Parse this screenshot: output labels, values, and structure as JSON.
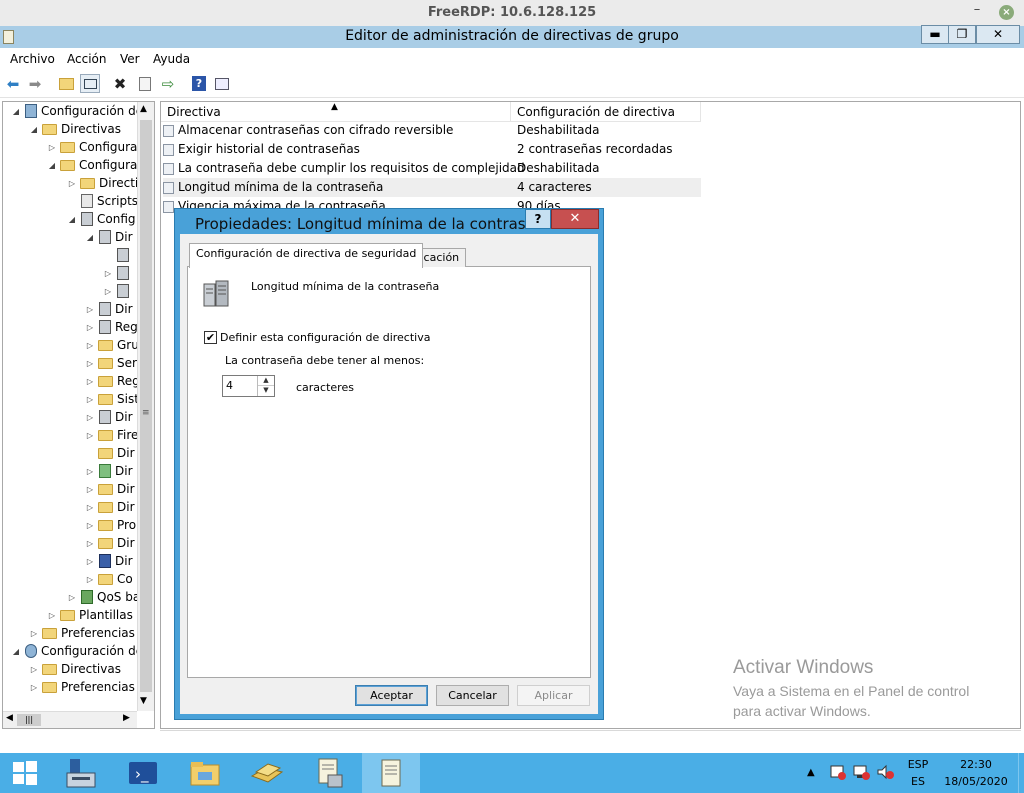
{
  "rdp": {
    "title": "FreeRDP: 10.6.128.125",
    "minimize": "–",
    "close": "×"
  },
  "app": {
    "title": "Editor de administración de directivas de grupo",
    "window_buttons": {
      "minimize": "▬",
      "restore": "❐",
      "close": "✕"
    }
  },
  "menu": [
    "Archivo",
    "Acción",
    "Ver",
    "Ayuda"
  ],
  "toolbar_icons": [
    "back-arrow-icon",
    "forward-arrow-icon",
    "up-folder-icon",
    "show-hide-tree-icon",
    "delete-icon",
    "properties-icon",
    "export-icon",
    "help-icon",
    "view-icon"
  ],
  "tree": [
    {
      "label": "Configuración de",
      "icon": "computer-icon"
    },
    {
      "label": "Directivas",
      "icon": "folder-icon"
    },
    {
      "label": "Configura",
      "icon": "folder-icon"
    },
    {
      "label": "Configura",
      "icon": "folder-icon"
    },
    {
      "label": "Directi",
      "icon": "folder-icon"
    },
    {
      "label": "Scripts",
      "icon": "script-icon"
    },
    {
      "label": "Config",
      "icon": "security-icon"
    },
    {
      "label": "Dir",
      "icon": "policy-icon"
    },
    {
      "label": "",
      "icon": "policy-icon"
    },
    {
      "label": "",
      "icon": "policy-icon"
    },
    {
      "label": "",
      "icon": "policy-icon"
    },
    {
      "label": "Dir",
      "icon": "policy-icon"
    },
    {
      "label": "Reg",
      "icon": "registry-icon"
    },
    {
      "label": "Gru",
      "icon": "lock-folder-icon"
    },
    {
      "label": "Ser",
      "icon": "lock-folder-icon"
    },
    {
      "label": "Reg",
      "icon": "lock-folder-icon"
    },
    {
      "label": "Sist",
      "icon": "lock-folder-icon"
    },
    {
      "label": "Dir",
      "icon": "network-icon"
    },
    {
      "label": "Fire",
      "icon": "folder-icon"
    },
    {
      "label": "Dir",
      "icon": "folder-icon"
    },
    {
      "label": "Dir",
      "icon": "chart-icon"
    },
    {
      "label": "Dir",
      "icon": "folder-icon"
    },
    {
      "label": "Dir",
      "icon": "folder-icon"
    },
    {
      "label": "Pro",
      "icon": "folder-icon"
    },
    {
      "label": "Dir",
      "icon": "folder-icon"
    },
    {
      "label": "Dir",
      "icon": "shield-icon"
    },
    {
      "label": "Co",
      "icon": "folder-icon"
    },
    {
      "label": "QoS ba",
      "icon": "qos-chart-icon"
    },
    {
      "label": "Plantillas a",
      "icon": "folder-icon"
    },
    {
      "label": "Preferencias",
      "icon": "folder-icon"
    },
    {
      "label": "Configuración de",
      "icon": "user-icon"
    },
    {
      "label": "Directivas",
      "icon": "folder-icon"
    },
    {
      "label": "Preferencias",
      "icon": "folder-icon"
    }
  ],
  "list": {
    "columns": [
      "Directiva",
      "Configuración de directiva"
    ],
    "rows": [
      {
        "name": "Almacenar contraseñas con cifrado reversible",
        "value": "Deshabilitada"
      },
      {
        "name": "Exigir historial de contraseñas",
        "value": "2 contraseñas recordadas"
      },
      {
        "name": "La contraseña debe cumplir los requisitos de complejidad",
        "value": "Deshabilitada"
      },
      {
        "name": "Longitud mínima de la contraseña",
        "value": "4 caracteres"
      },
      {
        "name": "Vigencia máxima de la contraseña",
        "value": "90 días"
      }
    ]
  },
  "watermark": {
    "title": "Activar Windows",
    "line1": "Vaya a Sistema en el Panel de control",
    "line2": "para activar Windows."
  },
  "dialog": {
    "title": "Propiedades: Longitud mínima de la contraseña",
    "help": "?",
    "close": "✕",
    "tabs": [
      "Configuración de directiva de seguridad",
      "Explicación"
    ],
    "policy_name": "Longitud mínima de la contraseña",
    "checkbox_label": "Definir esta configuración de directiva",
    "checked": true,
    "prompt": "La contraseña debe tener al menos:",
    "spin_value": "4",
    "unit": "caracteres",
    "buttons": {
      "ok": "Aceptar",
      "cancel": "Cancelar",
      "apply": "Aplicar"
    }
  },
  "taskbar": {
    "apps": [
      "start-icon",
      "server-manager-icon",
      "powershell-icon",
      "file-explorer-icon",
      "gpmc-icon",
      "notepad-icon",
      "policy-editor-icon"
    ],
    "tray": {
      "lang_top": "ESP",
      "lang_bottom": "ES",
      "time": "22:30",
      "date": "18/05/2020"
    }
  },
  "colors": {
    "title_bar": "#a9cde6",
    "dialog_border": "#49a1d8",
    "taskbar": "#4aaee6",
    "close_red": "#c75050"
  }
}
